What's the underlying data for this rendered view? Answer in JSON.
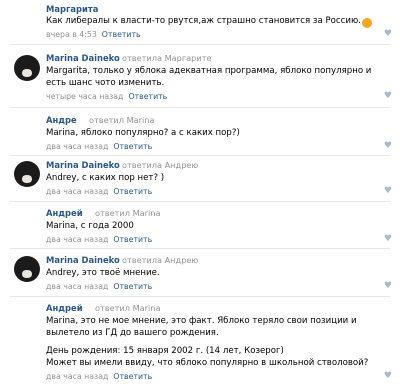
{
  "comments": [
    {
      "author": "Маргарита",
      "replied": "",
      "text": "Как либералы к власти-то рвутся,аж страшно становится за Россию.",
      "emoji": "😮",
      "time": "вчера в 4:53",
      "reply_label": "Ответить"
    },
    {
      "author": "Marina Daineko",
      "replied": "ответила Маргарите",
      "text": "Margarita, только у яблока адекватная программа, яблоко популярно и есть шанс чото изменить.",
      "time": "четыре часа назад",
      "reply_label": "Ответить"
    },
    {
      "author": "Андре",
      "replied": "ответил Marina",
      "text": "Marina, яблоко популярно? а с каких пор?)",
      "time": "два часа назад",
      "reply_label": "Ответить"
    },
    {
      "author": "Marina Daineko",
      "replied": "ответила Андрею",
      "text": "Andrey, с каких пор нет? )",
      "time": "два часа назад",
      "reply_label": "Ответить"
    },
    {
      "author": "Андрей",
      "replied": "ответил Marina",
      "text": "Marina, с года 2000",
      "time": "два часа назад",
      "reply_label": "Ответить"
    },
    {
      "author": "Marina Daineko",
      "replied": "ответила Андрею",
      "text": "Andrey, это твоё мнение.",
      "time": "два часа назад",
      "reply_label": "Ответить"
    },
    {
      "author": "Андрей",
      "replied": "ответил Marina",
      "text": "Marina, это не мое мнение, это факт. Яблоко теряло свои позиции и вылетело из ГД до вашего рождения.",
      "text2": "День рождения: 15 января 2002 г. (14 лет, Козерог)",
      "text3": "Может вы имели ввиду, что яблоко популярно в школьной стволовой?",
      "time": "два часа назад",
      "reply_label": "Ответить"
    }
  ],
  "colors": {
    "link": "#2a5885",
    "muted": "#939393",
    "heart": "#a9b8ca"
  },
  "icons": {
    "like": "heart-icon",
    "avatar": "user-avatar"
  }
}
